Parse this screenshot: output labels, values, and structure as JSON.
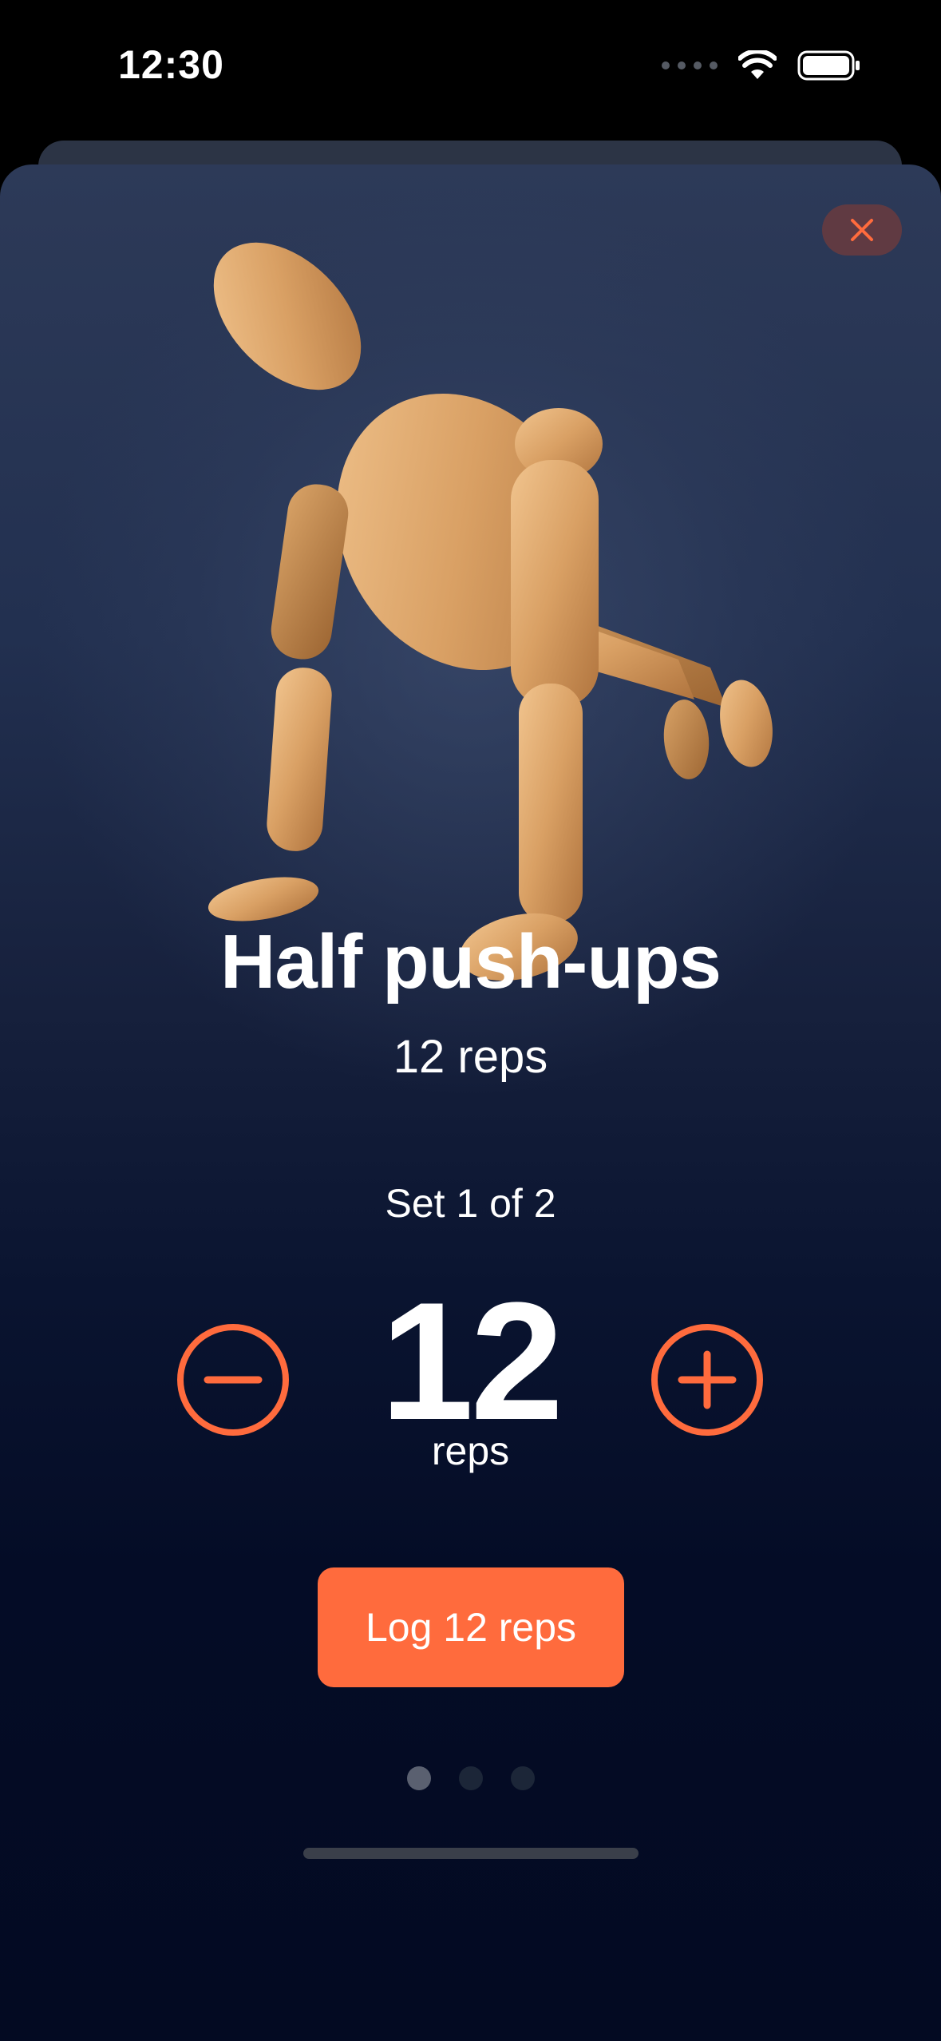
{
  "status_bar": {
    "time": "12:30"
  },
  "exercise": {
    "title": "Half push-ups",
    "target": "12 reps"
  },
  "set": {
    "label": "Set 1 of 2"
  },
  "counter": {
    "value": "12",
    "unit": "reps"
  },
  "log_button": {
    "label": "Log 12 reps"
  },
  "pager": {
    "count": 3,
    "active_index": 0
  },
  "colors": {
    "accent": "#ff6b3d",
    "background_top": "#2d3a58",
    "background_bottom": "#030a22"
  },
  "icons": {
    "close": "close-icon",
    "minus": "minus-circle-icon",
    "plus": "plus-circle-icon",
    "wifi": "wifi-icon",
    "battery": "battery-icon"
  }
}
